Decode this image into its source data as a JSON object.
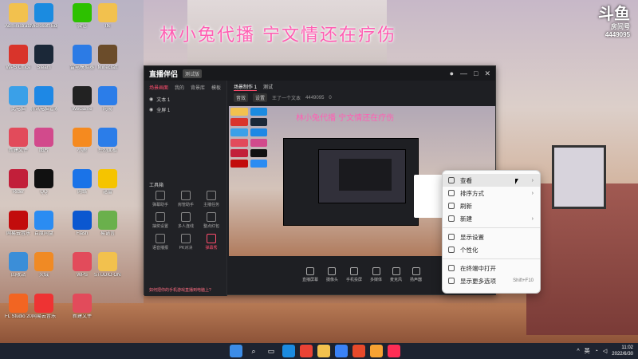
{
  "overlay": {
    "title": "林小兔代播 宁文情还在疗伤"
  },
  "brand": {
    "name": "斗鱼",
    "sub": "房间号",
    "room": "4449095"
  },
  "desktop_icons": [
    {
      "label": "Administrator",
      "icon": "folder-icon",
      "color": "#f2c14e"
    },
    {
      "label": "Microsoft Edge",
      "icon": "edge-icon",
      "color": "#1b8be0"
    },
    {
      "label": "微信",
      "icon": "wechat-icon",
      "color": "#2dc100"
    },
    {
      "label": "Ifk",
      "icon": "folder-icon",
      "color": "#f2c14e"
    },
    {
      "label": "WPS Office",
      "icon": "wps-icon",
      "color": "#d9342b"
    },
    {
      "label": "Steam",
      "icon": "steam-icon",
      "color": "#1b2838"
    },
    {
      "label": "雷电模拟器",
      "icon": "ldplayer-icon",
      "color": "#2c7be5"
    },
    {
      "label": "Minecraft",
      "icon": "minecraft-icon",
      "color": "#6b4c2a"
    },
    {
      "label": "此电脑",
      "icon": "pc-icon",
      "color": "#3aa0e8"
    },
    {
      "label": "腾讯电脑管家",
      "icon": "shield-icon",
      "color": "#1e88e5"
    },
    {
      "label": "WeGame",
      "icon": "wegame-icon",
      "color": "#222"
    },
    {
      "label": "网易",
      "icon": "windows-icon",
      "color": "#2b7de9"
    },
    {
      "label": "新建文件",
      "icon": "doc-icon",
      "color": "#e24b5b"
    },
    {
      "label": "图片",
      "icon": "photos-icon",
      "color": "#d24a8c"
    },
    {
      "label": "小鹿",
      "icon": "app-icon",
      "color": "#f58a1f"
    },
    {
      "label": "控制面板",
      "icon": "windows-icon",
      "color": "#2b7de9"
    },
    {
      "label": "Rider",
      "icon": "rider-icon",
      "color": "#c21f3a"
    },
    {
      "label": "QQ",
      "icon": "qq-icon",
      "color": "#111"
    },
    {
      "label": "网络",
      "icon": "globe-icon",
      "color": "#1a73e8"
    },
    {
      "label": "迅雷",
      "icon": "thunder-icon",
      "color": "#f5c400"
    },
    {
      "label": "网易云音乐",
      "icon": "netease-icon",
      "color": "#c20c0c"
    },
    {
      "label": "百度网盘",
      "icon": "cloud-icon",
      "color": "#2b8cf2"
    },
    {
      "label": "Flash",
      "icon": "flash-icon",
      "color": "#0b57d0"
    },
    {
      "label": "易语言",
      "icon": "app-icon",
      "color": "#6ab04c"
    },
    {
      "label": "回收站",
      "icon": "recycle-icon",
      "color": "#3b8ed8"
    },
    {
      "label": "火绒",
      "icon": "fire-icon",
      "color": "#f08a24"
    },
    {
      "label": "WPS",
      "icon": "doc-icon",
      "color": "#e24b5b"
    },
    {
      "label": "STUDIO ONE",
      "icon": "folder-icon",
      "color": "#f2c14e"
    },
    {
      "label": "FL Studio 20",
      "icon": "fl-icon",
      "color": "#f26522"
    },
    {
      "label": "网易云音乐",
      "icon": "netease-icon",
      "color": "#e33"
    },
    {
      "label": "新建文件",
      "icon": "doc-icon",
      "color": "#e24b5b"
    }
  ],
  "app": {
    "name": "直播伴侣",
    "version": "测试版",
    "side_tabs": [
      "场景画面",
      "我的",
      "背景库",
      "模板"
    ],
    "scenes": [
      "文本 1",
      "全屏 1"
    ],
    "tools_title": "工具箱",
    "tools": [
      "弹幕助手",
      "房管助手",
      "主播任务",
      "抽奖设置",
      "多人连线",
      "整点红包",
      "语音播报",
      "PK对决",
      "弹幕秀"
    ],
    "active_tool": "弹幕秀",
    "tip": "如何把你的手机游戏直播到电脑上?",
    "head_tabs": [
      "场景制作 1",
      "测试"
    ],
    "head_info": [
      "音效",
      "设置",
      "王了一个文本",
      "4449095",
      "0"
    ],
    "preview_text": "林小兔代播 宁文情还在疗伤",
    "bottom_buttons": [
      "直播屏幕",
      "摄像头",
      "手机投屏",
      "多媒体",
      "麦克风",
      "扬声器"
    ]
  },
  "context_menu": [
    {
      "label": "查看",
      "icon": "grid-icon",
      "submenu": true,
      "shortcut": ""
    },
    {
      "label": "排序方式",
      "icon": "sort-icon",
      "submenu": true,
      "shortcut": ""
    },
    {
      "label": "刷新",
      "icon": "refresh-icon",
      "submenu": false,
      "shortcut": ""
    },
    {
      "label": "新建",
      "icon": "plus-icon",
      "submenu": true,
      "shortcut": ""
    },
    {
      "label": "显示设置",
      "icon": "display-icon",
      "submenu": false,
      "shortcut": ""
    },
    {
      "label": "个性化",
      "icon": "brush-icon",
      "submenu": false,
      "shortcut": ""
    },
    {
      "label": "在终端中打开",
      "icon": "terminal-icon",
      "submenu": false,
      "shortcut": ""
    },
    {
      "label": "显示更多选项",
      "icon": "more-icon",
      "submenu": false,
      "shortcut": "Shift+F10"
    }
  ],
  "taskbar": {
    "apps": [
      {
        "icon": "start-icon",
        "color": "#3c8ce7"
      },
      {
        "icon": "search-icon",
        "color": "#ffffff"
      },
      {
        "icon": "taskview-icon",
        "color": "#ffffff"
      },
      {
        "icon": "edge-icon",
        "color": "#1b8be0"
      },
      {
        "icon": "chrome-icon",
        "color": "#e94235"
      },
      {
        "icon": "explorer-icon",
        "color": "#f2c14e"
      },
      {
        "icon": "mail-icon",
        "color": "#3a82f7"
      },
      {
        "icon": "office-icon",
        "color": "#e84a2b"
      },
      {
        "icon": "store-icon",
        "color": "#f7a233"
      },
      {
        "icon": "live-icon",
        "color": "#ff2d55"
      }
    ],
    "ime": "英",
    "time": "11:02",
    "date": "2022/6/30"
  }
}
